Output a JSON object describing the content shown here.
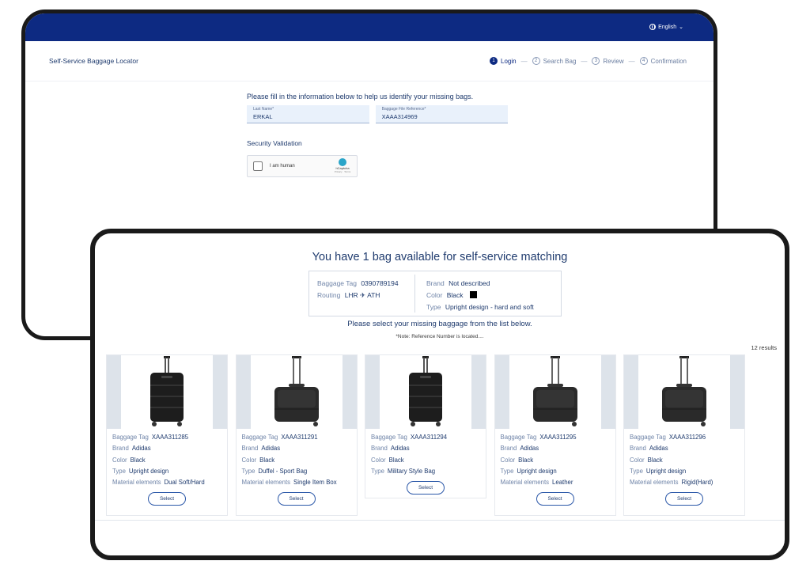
{
  "login_screen": {
    "language": "English",
    "app_title": "Self-Service Baggage Locator",
    "steps": [
      {
        "num": "1",
        "label": "Login",
        "active": true
      },
      {
        "num": "2",
        "label": "Search Bag",
        "active": false
      },
      {
        "num": "3",
        "label": "Review",
        "active": false
      },
      {
        "num": "4",
        "label": "Confirmation",
        "active": false
      }
    ],
    "step_separator": "—",
    "instruction": "Please fill in the information below to help us identify your missing bags.",
    "fields": [
      {
        "label": "Last Name*",
        "value": "ERKAL"
      },
      {
        "label": "Baggage File Reference*",
        "value": "XAAA314969"
      }
    ],
    "security_title": "Security Validation",
    "captcha": {
      "text": "I am human",
      "brand": "hCaptcha",
      "terms": "Privacy · Terms"
    }
  },
  "results_screen": {
    "heading": "You have 1 bag available for self-service matching",
    "bag_info": {
      "left": [
        {
          "label": "Baggage Tag",
          "value": "0390789194"
        },
        {
          "label": "Routing",
          "value": "LHR ✈ ATH"
        }
      ],
      "right": [
        {
          "label": "Brand",
          "value": "Not described"
        },
        {
          "label": "Color",
          "value": "Black"
        },
        {
          "label": "Type",
          "value": "Upright design - hard and soft"
        }
      ],
      "color_swatch": "#000000"
    },
    "select_prompt": "Please select your missing baggage from the list below.",
    "note": "*Note: Reference Number is located....",
    "results_count": "12 results",
    "cards": [
      {
        "bag": "hardshell",
        "rows": [
          {
            "label": "Baggage Tag",
            "value": "XAAA311285"
          },
          {
            "label": "Brand",
            "value": "Adidas"
          },
          {
            "label": "Color",
            "value": "Black"
          },
          {
            "label": "Type",
            "value": "Upright design"
          },
          {
            "label": "Material elements",
            "value": "Dual Soft/Hard"
          }
        ],
        "button": "Select"
      },
      {
        "bag": "pilot",
        "rows": [
          {
            "label": "Baggage Tag",
            "value": "XAAA311291"
          },
          {
            "label": "Brand",
            "value": "Adidas"
          },
          {
            "label": "Color",
            "value": "Black"
          },
          {
            "label": "Type",
            "value": "Duffel - Sport Bag"
          },
          {
            "label": "Material elements",
            "value": "Single Item Box"
          }
        ],
        "button": "Select"
      },
      {
        "bag": "hardshell",
        "rows": [
          {
            "label": "Baggage Tag",
            "value": "XAAA311294"
          },
          {
            "label": "Brand",
            "value": "Adidas"
          },
          {
            "label": "Color",
            "value": "Black"
          },
          {
            "label": "Type",
            "value": "Military Style Bag"
          }
        ],
        "button": "Select"
      },
      {
        "bag": "pilot",
        "rows": [
          {
            "label": "Baggage Tag",
            "value": "XAAA311295"
          },
          {
            "label": "Brand",
            "value": "Adidas"
          },
          {
            "label": "Color",
            "value": "Black"
          },
          {
            "label": "Type",
            "value": "Upright design"
          },
          {
            "label": "Material elements",
            "value": "Leather"
          }
        ],
        "button": "Select"
      },
      {
        "bag": "pilot",
        "rows": [
          {
            "label": "Baggage Tag",
            "value": "XAAA311296"
          },
          {
            "label": "Brand",
            "value": "Adidas"
          },
          {
            "label": "Color",
            "value": "Black"
          },
          {
            "label": "Type",
            "value": "Upright design"
          },
          {
            "label": "Material elements",
            "value": "Rigid(Hard)"
          }
        ],
        "button": "Select"
      }
    ]
  },
  "colors": {
    "brand_navy": "#0d2a82",
    "text_navy": "#1f3b6e",
    "label_blue": "#6f84a8",
    "field_bg": "#e9f1fb"
  },
  "icons": [
    "globe-icon",
    "chevron-down-icon",
    "hcaptcha-icon",
    "plane-icon",
    "suitcase-icon"
  ]
}
